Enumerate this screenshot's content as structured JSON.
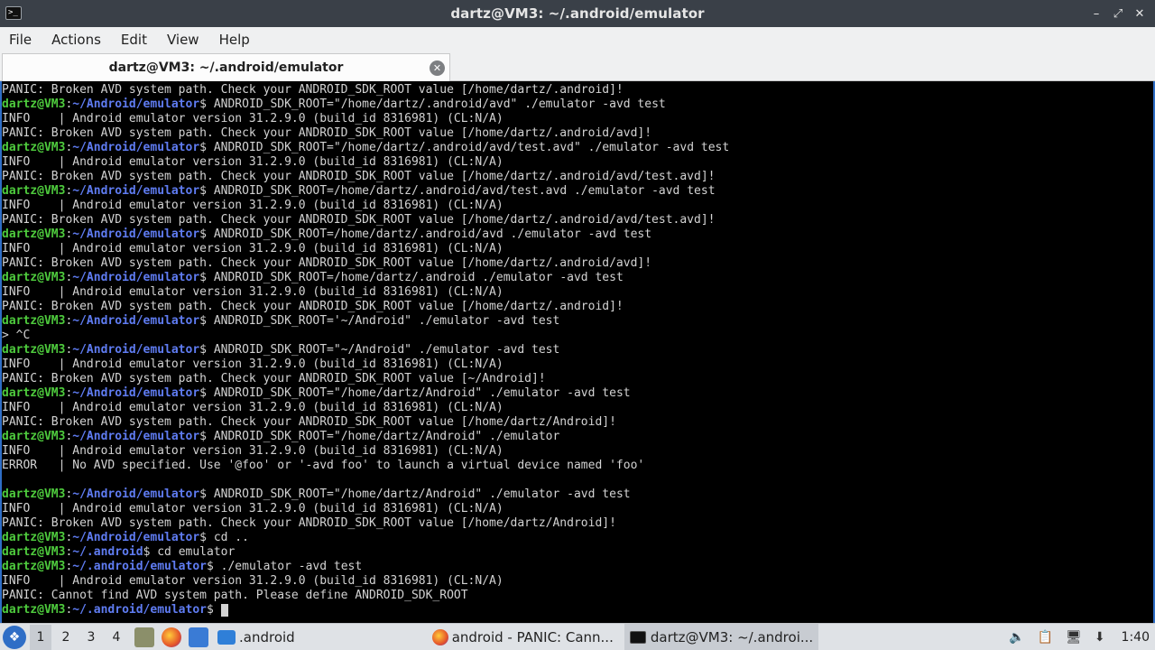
{
  "window": {
    "title": "dartz@VM3: ~/.android/emulator",
    "icon_glyph": ">_",
    "controls": {
      "minimize": "–",
      "maximize": "⤢",
      "close": "✕"
    }
  },
  "menu": [
    "File",
    "Actions",
    "Edit",
    "View",
    "Help"
  ],
  "tab": {
    "label": "dartz@VM3: ~/.android/emulator",
    "close_glyph": "✕"
  },
  "terminal": {
    "lines": [
      {
        "t": "PANIC: Broken AVD system path. Check your ANDROID_SDK_ROOT value [/home/dartz/.android]!"
      },
      {
        "u": "dartz@VM3",
        "p": "~/Android/emulator",
        "c": "$ ANDROID_SDK_ROOT=\"/home/dartz/.android/avd\" ./emulator -avd test"
      },
      {
        "t": "INFO    | Android emulator version 31.2.9.0 (build_id 8316981) (CL:N/A)"
      },
      {
        "t": "PANIC: Broken AVD system path. Check your ANDROID_SDK_ROOT value [/home/dartz/.android/avd]!"
      },
      {
        "u": "dartz@VM3",
        "p": "~/Android/emulator",
        "c": "$ ANDROID_SDK_ROOT=\"/home/dartz/.android/avd/test.avd\" ./emulator -avd test"
      },
      {
        "t": "INFO    | Android emulator version 31.2.9.0 (build_id 8316981) (CL:N/A)"
      },
      {
        "t": "PANIC: Broken AVD system path. Check your ANDROID_SDK_ROOT value [/home/dartz/.android/avd/test.avd]!"
      },
      {
        "u": "dartz@VM3",
        "p": "~/Android/emulator",
        "c": "$ ANDROID_SDK_ROOT=/home/dartz/.android/avd/test.avd ./emulator -avd test"
      },
      {
        "t": "INFO    | Android emulator version 31.2.9.0 (build_id 8316981) (CL:N/A)"
      },
      {
        "t": "PANIC: Broken AVD system path. Check your ANDROID_SDK_ROOT value [/home/dartz/.android/avd/test.avd]!"
      },
      {
        "u": "dartz@VM3",
        "p": "~/Android/emulator",
        "c": "$ ANDROID_SDK_ROOT=/home/dartz/.android/avd ./emulator -avd test"
      },
      {
        "t": "INFO    | Android emulator version 31.2.9.0 (build_id 8316981) (CL:N/A)"
      },
      {
        "t": "PANIC: Broken AVD system path. Check your ANDROID_SDK_ROOT value [/home/dartz/.android/avd]!"
      },
      {
        "u": "dartz@VM3",
        "p": "~/Android/emulator",
        "c": "$ ANDROID_SDK_ROOT=/home/dartz/.android ./emulator -avd test"
      },
      {
        "t": "INFO    | Android emulator version 31.2.9.0 (build_id 8316981) (CL:N/A)"
      },
      {
        "t": "PANIC: Broken AVD system path. Check your ANDROID_SDK_ROOT value [/home/dartz/.android]!"
      },
      {
        "u": "dartz@VM3",
        "p": "~/Android/emulator",
        "c": "$ ANDROID_SDK_ROOT='~/Android\" ./emulator -avd test"
      },
      {
        "t": "> ^C"
      },
      {
        "u": "dartz@VM3",
        "p": "~/Android/emulator",
        "c": "$ ANDROID_SDK_ROOT=\"~/Android\" ./emulator -avd test"
      },
      {
        "t": "INFO    | Android emulator version 31.2.9.0 (build_id 8316981) (CL:N/A)"
      },
      {
        "t": "PANIC: Broken AVD system path. Check your ANDROID_SDK_ROOT value [~/Android]!"
      },
      {
        "u": "dartz@VM3",
        "p": "~/Android/emulator",
        "c": "$ ANDROID_SDK_ROOT=\"/home/dartz/Android\" ./emulator -avd test"
      },
      {
        "t": "INFO    | Android emulator version 31.2.9.0 (build_id 8316981) (CL:N/A)"
      },
      {
        "t": "PANIC: Broken AVD system path. Check your ANDROID_SDK_ROOT value [/home/dartz/Android]!"
      },
      {
        "u": "dartz@VM3",
        "p": "~/Android/emulator",
        "c": "$ ANDROID_SDK_ROOT=\"/home/dartz/Android\" ./emulator"
      },
      {
        "t": "INFO    | Android emulator version 31.2.9.0 (build_id 8316981) (CL:N/A)"
      },
      {
        "t": "ERROR   | No AVD specified. Use '@foo' or '-avd foo' to launch a virtual device named 'foo'"
      },
      {
        "t": ""
      },
      {
        "u": "dartz@VM3",
        "p": "~/Android/emulator",
        "c": "$ ANDROID_SDK_ROOT=\"/home/dartz/Android\" ./emulator -avd test"
      },
      {
        "t": "INFO    | Android emulator version 31.2.9.0 (build_id 8316981) (CL:N/A)"
      },
      {
        "t": "PANIC: Broken AVD system path. Check your ANDROID_SDK_ROOT value [/home/dartz/Android]!"
      },
      {
        "u": "dartz@VM3",
        "p": "~/Android/emulator",
        "c": "$ cd .."
      },
      {
        "u": "dartz@VM3",
        "p": "~/.android",
        "c": "$ cd emulator"
      },
      {
        "u": "dartz@VM3",
        "p": "~/.android/emulator",
        "c": "$ ./emulator -avd test"
      },
      {
        "t": "INFO    | Android emulator version 31.2.9.0 (build_id 8316981) (CL:N/A)"
      },
      {
        "t": "PANIC: Cannot find AVD system path. Please define ANDROID_SDK_ROOT"
      },
      {
        "u": "dartz@VM3",
        "p": "~/.android/emulator",
        "c": "$ ",
        "cursor": true
      }
    ]
  },
  "taskbar": {
    "workspaces": [
      "1",
      "2",
      "3",
      "4"
    ],
    "folder_label": ".android",
    "tasks": [
      {
        "label": "android - PANIC: Cann...",
        "icon": "firefox-icon"
      },
      {
        "label": "dartz@VM3: ~/.androi...",
        "icon": "terminal-icon"
      }
    ],
    "clock": "1:40"
  }
}
